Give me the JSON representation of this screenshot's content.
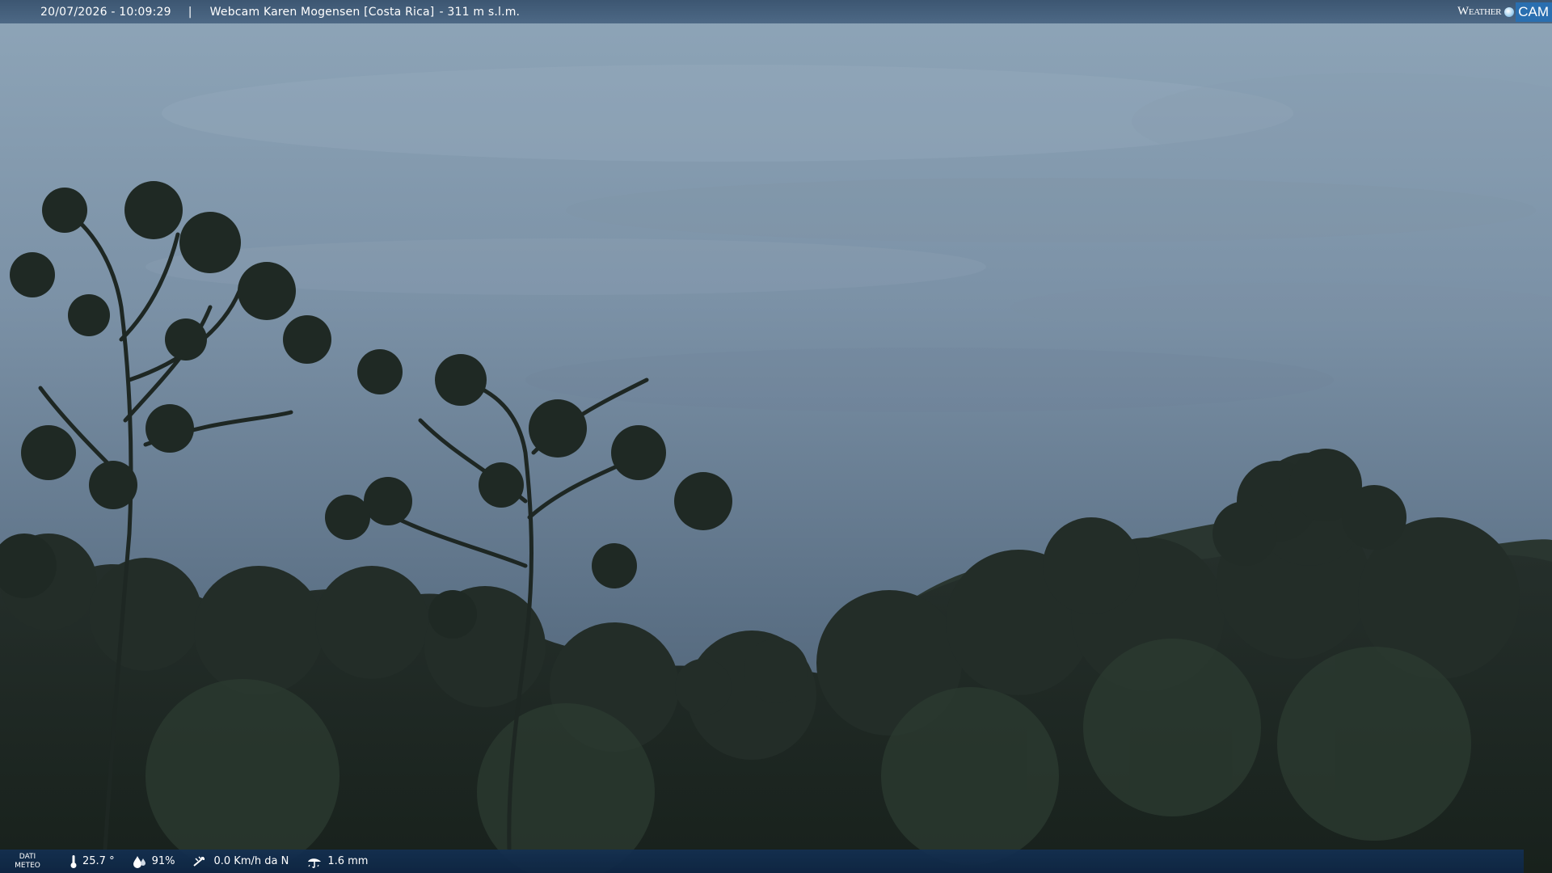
{
  "top_bar": {
    "timestamp": "20/07/2026 - 10:09:29",
    "separator": "|",
    "webcam_title": "Webcam Karen Mogensen [Costa Rica]",
    "altitude": "- 311 m s.l.m."
  },
  "brand": {
    "word": "Weather",
    "cam": "CAM"
  },
  "bottom_bar": {
    "dati_line1": "DATI",
    "dati_line2": "METEO",
    "temperature": "25.7 °",
    "humidity": "91%",
    "wind": "0.0 Km/h da N",
    "rain": "1.6 mm"
  },
  "icons": [
    "thermometer-icon",
    "humidity-drop-icon",
    "wind-icon",
    "rain-icon"
  ],
  "colors": {
    "sky_top": "#8fa6ba",
    "sky_bottom": "#4e6275",
    "foliage": "#1f2a24",
    "bar_top": "#3e5a78",
    "bar_bottom": "#123056"
  }
}
